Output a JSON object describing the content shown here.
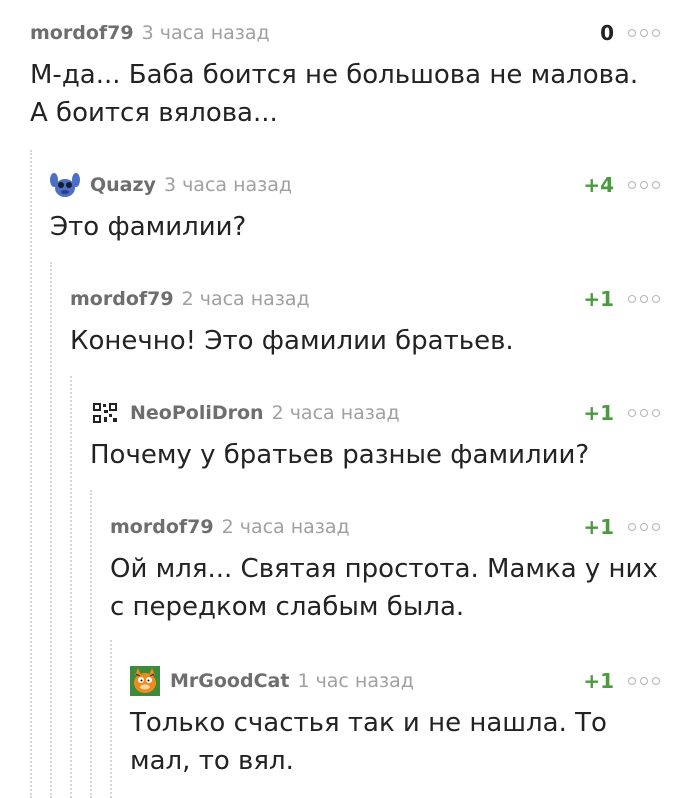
{
  "comments": [
    {
      "author": "mordof79",
      "time": "3 часа назад",
      "rating": "0",
      "text": "М-да... Баба боится не большова не малова. А боится вялова...",
      "avatar": "none"
    },
    {
      "author": "Quazy",
      "time": "3 часа назад",
      "rating": "+4",
      "text": "Это фамилии?",
      "avatar": "stitch-avatar"
    },
    {
      "author": "mordof79",
      "time": "2 часа назад",
      "rating": "+1",
      "text": "Конечно! Это фамилии братьев.",
      "avatar": "none"
    },
    {
      "author": "NeoPoliDron",
      "time": "2 часа назад",
      "rating": "+1",
      "text": "Почему у братьев разные фамилии?",
      "avatar": "qr-code-avatar"
    },
    {
      "author": "mordof79",
      "time": "2 часа назад",
      "rating": "+1",
      "text": "Ой мля... Святая простота. Мамка у них с передком слабым была.",
      "avatar": "none"
    },
    {
      "author": "MrGoodCat",
      "time": "1 час назад",
      "rating": "+1",
      "text": "Только счастья так и не нашла. То мал, то вял.",
      "avatar": "garfield-avatar"
    }
  ],
  "colors": {
    "positive": "#4a9a3e",
    "author": "#6e6e6e",
    "time": "#a0a0a0",
    "thread_line": "#d7d7d7"
  }
}
